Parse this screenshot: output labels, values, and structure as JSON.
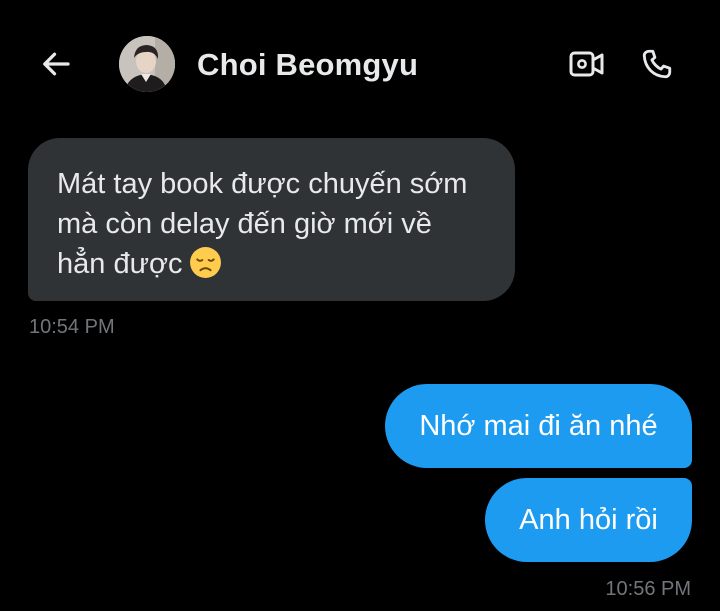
{
  "header": {
    "contact_name": "Choi Beomgyu",
    "icons": {
      "back": "arrow-left-icon",
      "video": "video-camera-icon",
      "call": "phone-icon"
    }
  },
  "messages": [
    {
      "direction": "incoming",
      "lines": [
        "Mát tay book được chuyến sớm",
        "mà còn delay đến giờ mới về",
        "hẳn được"
      ],
      "emoji": "disappointed-face",
      "time": "10:54 PM"
    },
    {
      "direction": "outgoing",
      "text": "Nhớ mai đi ăn nhé"
    },
    {
      "direction": "outgoing",
      "text": "Anh hỏi rồi",
      "time": "10:56 PM"
    }
  ],
  "colors": {
    "background": "#000000",
    "incoming_bubble": "#2f3336",
    "outgoing_bubble": "#1d9bf0",
    "timestamp": "#71767b",
    "text": "#e7e9ea"
  }
}
